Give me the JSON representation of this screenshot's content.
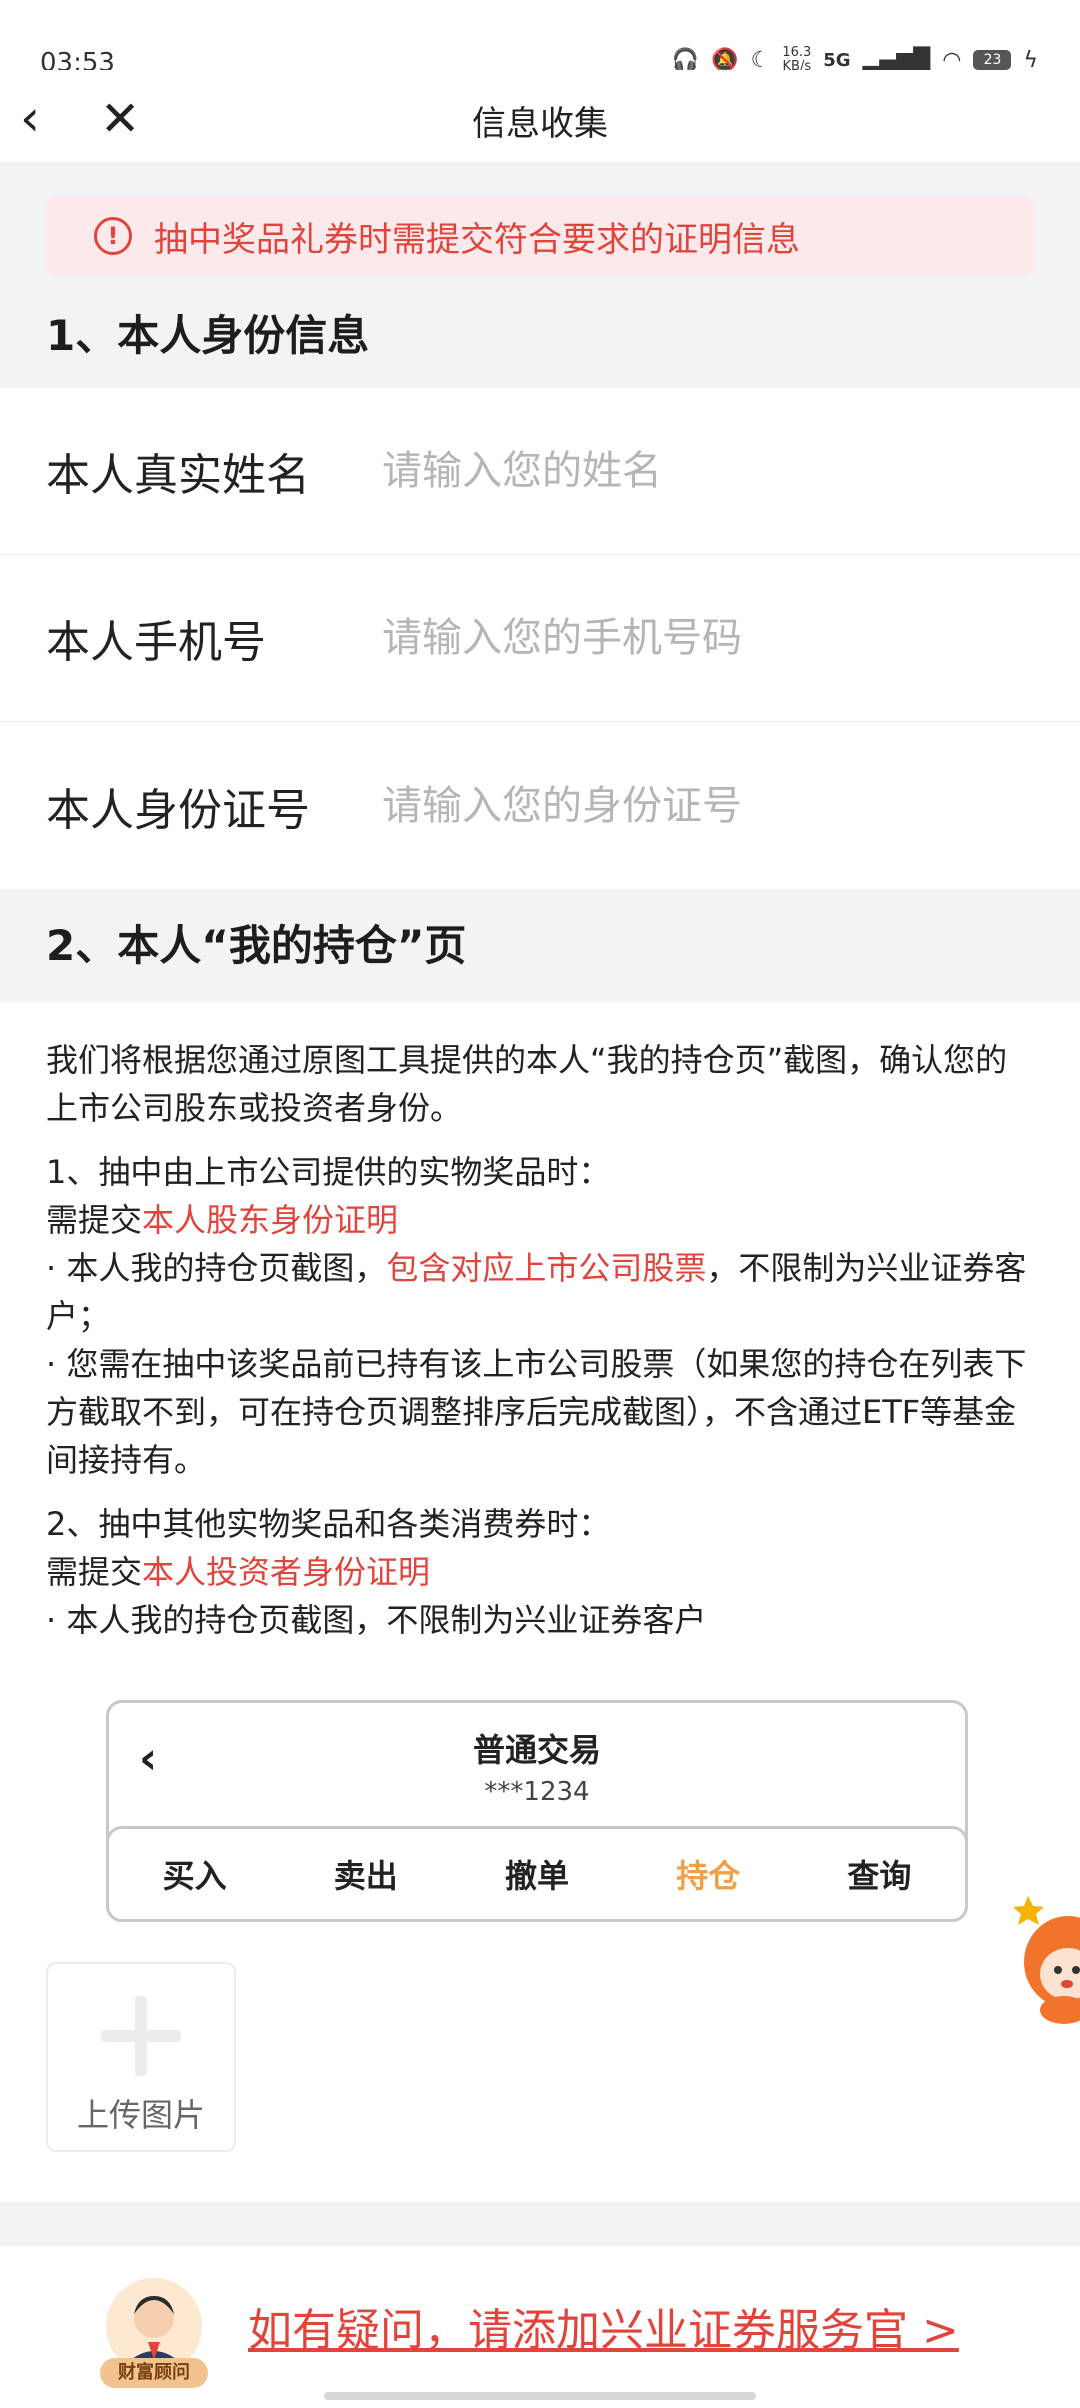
{
  "status_bar": {
    "time": "03:53",
    "net_speed": "16.3\nKB/s",
    "network": "5G",
    "battery": "23"
  },
  "nav": {
    "back_icon": "‹",
    "close_icon": "✕",
    "title": "信息收集"
  },
  "notice": {
    "icon": "!",
    "text": "抽中奖品礼券时需提交符合要求的证明信息"
  },
  "section1": {
    "title": "1、本人身份信息",
    "fields": [
      {
        "label": "本人真实姓名",
        "placeholder": "请输入您的姓名",
        "value": ""
      },
      {
        "label": "本人手机号",
        "placeholder": "请输入您的手机号码",
        "value": ""
      },
      {
        "label": "本人身份证号",
        "placeholder": "请输入您的身份证号",
        "value": ""
      }
    ]
  },
  "section2": {
    "title": "2、本人“我的持仓”页",
    "intro": "我们将根据您通过原图工具提供的本人“我的持仓页”截图，确认您的上市公司股东或投资者身份。",
    "rule1": {
      "heading": "1、抽中由上市公司提供的实物奖品时：",
      "req_prefix": "需提交",
      "req_highlight": "本人股东身份证明",
      "bullet1_a": "· 本人我的持仓页截图，",
      "bullet1_highlight": "包含对应上市公司股票",
      "bullet1_b": "，不限制为兴业证券客户；",
      "bullet2": "· 您需在抽中该奖品前已持有该上市公司股票（如果您的持仓在列表下方截取不到，可在持仓页调整排序后完成截图），不含通过ETF等基金间接持有。"
    },
    "rule2": {
      "heading": "2、抽中其他实物奖品和各类消费券时：",
      "req_prefix": "需提交",
      "req_highlight": "本人投资者身份证明",
      "bullet1": "· 本人我的持仓页截图，不限制为兴业证券客户"
    },
    "demo": {
      "back_icon": "‹",
      "title": "普通交易",
      "account": "***1234",
      "tabs": [
        "买入",
        "卖出",
        "撤单",
        "持仓",
        "查询"
      ],
      "active_tab": "持仓"
    },
    "upload": {
      "icon": "plus-icon",
      "label": "上传图片"
    }
  },
  "footer": {
    "advisor_tag": "财富顾问",
    "link": "如有疑问，请添加兴业证券服务官 >"
  },
  "colors": {
    "accent_red": "#e0443b",
    "notice_bg": "#fce9eb",
    "active_tab": "#f0a04a"
  }
}
